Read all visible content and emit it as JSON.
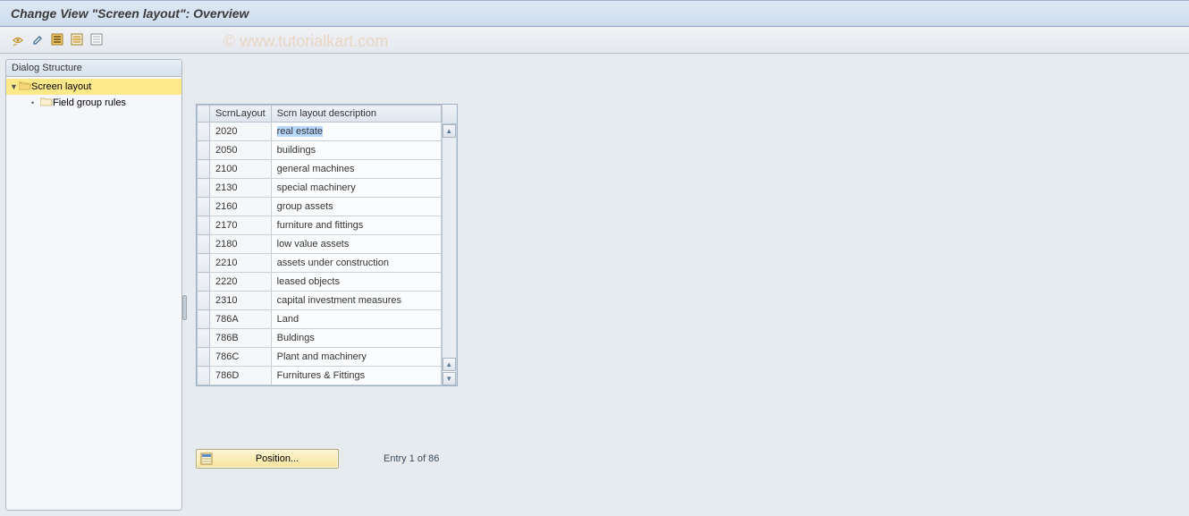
{
  "title": "Change View \"Screen layout\": Overview",
  "watermark": "© www.tutorialkart.com",
  "sidebar": {
    "header": "Dialog Structure",
    "root": {
      "label": "Screen layout",
      "expanded": true
    },
    "child": {
      "label": "Field group rules"
    }
  },
  "table": {
    "col1": "ScrnLayout",
    "col2": "Scrn layout description",
    "rows": [
      {
        "code": "2020",
        "desc": "real estate",
        "selected": true
      },
      {
        "code": "2050",
        "desc": "buildings"
      },
      {
        "code": "2100",
        "desc": "general machines"
      },
      {
        "code": "2130",
        "desc": "special machinery"
      },
      {
        "code": "2160",
        "desc": "group assets"
      },
      {
        "code": "2170",
        "desc": "furniture and fittings"
      },
      {
        "code": "2180",
        "desc": "low value assets"
      },
      {
        "code": "2210",
        "desc": "assets under construction"
      },
      {
        "code": "2220",
        "desc": "leased objects"
      },
      {
        "code": "2310",
        "desc": "capital investment measures"
      },
      {
        "code": "786A",
        "desc": "Land"
      },
      {
        "code": "786B",
        "desc": "Buldings"
      },
      {
        "code": "786C",
        "desc": "Plant and machinery"
      },
      {
        "code": "786D",
        "desc": "Furnitures & Fittings"
      }
    ]
  },
  "position_label": "Position...",
  "entry_text": "Entry 1 of 86",
  "icons": {
    "toolbar": [
      "toggle-display",
      "edit",
      "select-all",
      "select-block",
      "deselect-all"
    ]
  }
}
